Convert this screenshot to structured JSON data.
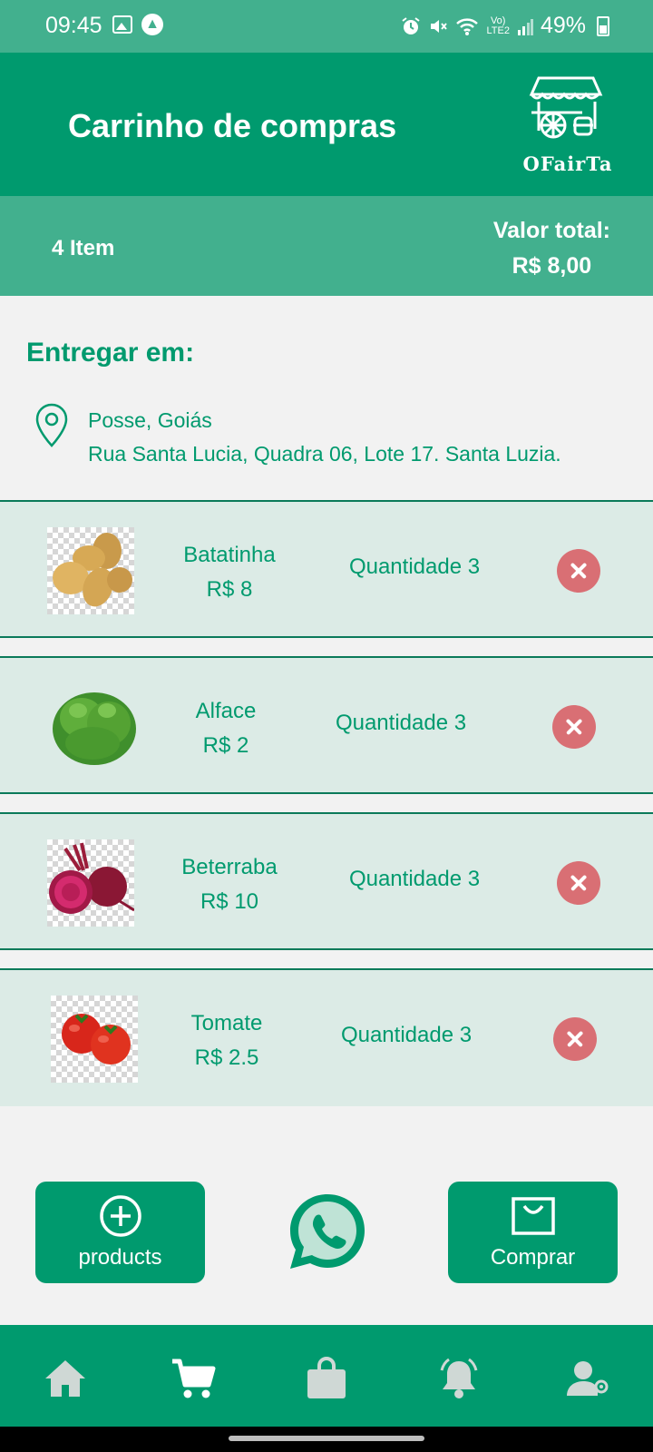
{
  "status_bar": {
    "time": "09:45",
    "battery": "49%",
    "icons": [
      "image-icon",
      "a-app-icon",
      "alarm-icon",
      "mute-icon",
      "wifi-icon",
      "volte-icon",
      "signal-icon",
      "battery-icon"
    ]
  },
  "header": {
    "title": "Carrinho de compras",
    "logo_text": "OFairTa"
  },
  "summary": {
    "item_count": "4 Item",
    "total_label": "Valor total:",
    "total_value": "R$ 8,00"
  },
  "delivery": {
    "title": "Entregar em:",
    "city": "Posse, Goiás",
    "street": "Rua Santa Lucia, Quadra 06, Lote 17. Santa Luzia."
  },
  "cart": {
    "items": [
      {
        "name": "Batatinha",
        "price": "R$ 8",
        "quantity": "Quantidade 3",
        "image": "potato"
      },
      {
        "name": "Alface",
        "price": "R$ 2",
        "quantity": "Quantidade 3",
        "image": "lettuce"
      },
      {
        "name": "Beterraba",
        "price": "R$ 10",
        "quantity": "Quantidade 3",
        "image": "beetroot"
      },
      {
        "name": "Tomate",
        "price": "R$ 2.5",
        "quantity": "Quantidade 3",
        "image": "tomato"
      }
    ]
  },
  "actions": {
    "products_label": "products",
    "buy_label": "Comprar"
  },
  "nav": {
    "items": [
      "home-icon",
      "cart-icon",
      "shopping-bag-icon",
      "bell-icon",
      "user-settings-icon"
    ],
    "active": "cart-icon"
  },
  "colors": {
    "primary": "#009a6e",
    "secondary": "#42b08e",
    "item_bg": "#dcebe6",
    "remove": "#d96f74",
    "page_bg": "#f2f2f2"
  }
}
